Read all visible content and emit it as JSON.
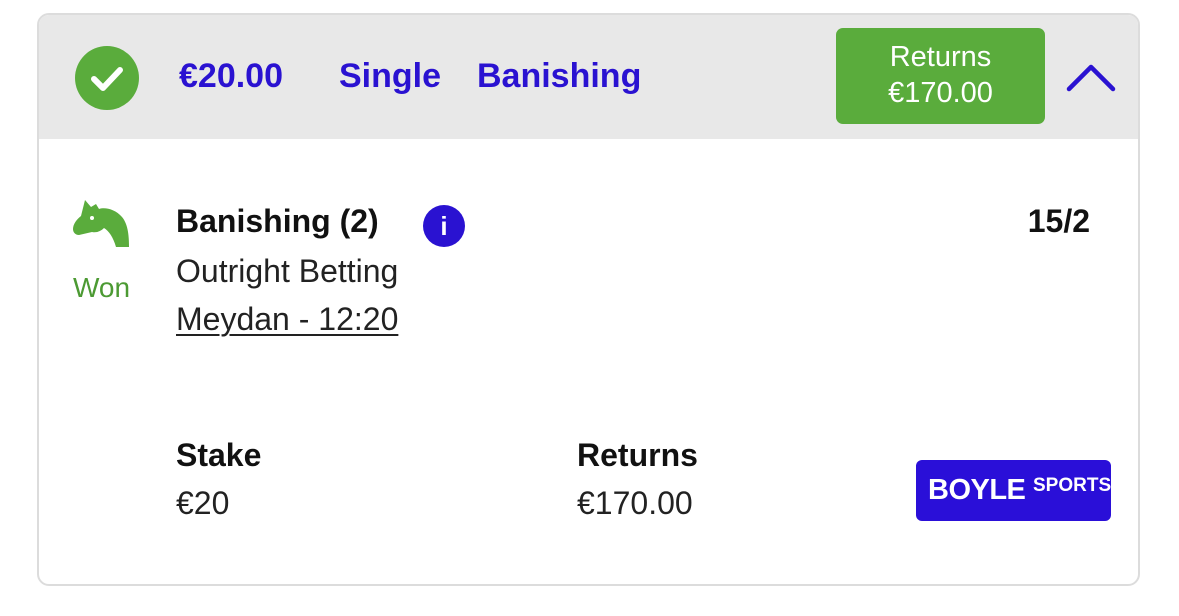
{
  "header": {
    "stake": "€20.00",
    "bet_type": "Single",
    "selection": "Banishing",
    "returns_label": "Returns",
    "returns_value": "€170.00",
    "accent": "#2a12d1",
    "status_color": "#5aac3c"
  },
  "leg": {
    "status": "Won",
    "selection": "Banishing (2)",
    "info_glyph": "i",
    "market": "Outright Betting",
    "event": "Meydan - 12:20",
    "odds": "15/2"
  },
  "summary": {
    "stake_label": "Stake",
    "stake_value": "€20",
    "returns_label": "Returns",
    "returns_value": "€170.00"
  },
  "brand": {
    "name_main": "BOYLE",
    "name_suffix": "SPORTS",
    "color": "#2a0fd8"
  },
  "icons": {
    "status": "check-circle-icon",
    "collapse": "chevron-up-icon",
    "sport": "horse-head-icon",
    "info": "info-icon"
  }
}
